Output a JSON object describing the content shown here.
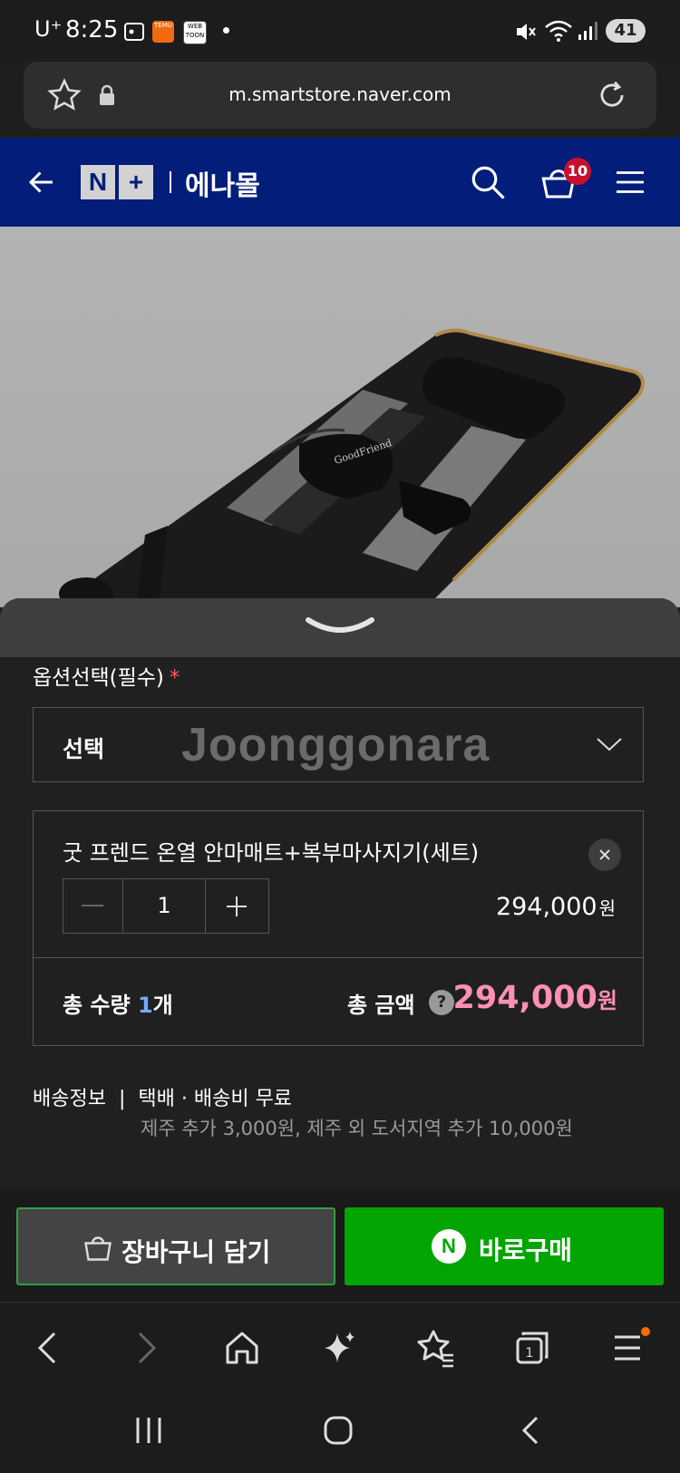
{
  "status_bar": {
    "carrier": "U⁺",
    "time": "8:25",
    "apps": [
      "TEMU",
      "WEB TOON"
    ],
    "battery": "41"
  },
  "url_bar": {
    "url": "m.smartstore.naver.com"
  },
  "store_header": {
    "logo_left": "N",
    "logo_right": "+",
    "store_name": "에나몰",
    "cart_count": "10"
  },
  "product_image": {
    "brand_text": "GoodFriend"
  },
  "options": {
    "label": "옵션선택(필수)",
    "required_mark": "*",
    "select_value": "선택",
    "watermark": "Joonggonara"
  },
  "selected_item": {
    "name": "굿 프렌드 온열 안마매트+복부마사지기(세트)",
    "quantity": "1",
    "price": "294,000",
    "price_unit": "원"
  },
  "total": {
    "quantity_label": "총 수량",
    "quantity_value": "1",
    "quantity_unit": "개",
    "amount_label": "총 금액",
    "help": "?",
    "amount": "294,000",
    "amount_unit": "원"
  },
  "shipping": {
    "label": "배송정보",
    "divider": "|",
    "method": "택배 · 배송비 무료",
    "extra": "제주 추가 3,000원, 제주 외 도서지역 추가 10,000원"
  },
  "actions": {
    "cart_label": "장바구니 담기",
    "buy_icon": "N",
    "buy_label": "바로구매"
  },
  "browser_nav": {
    "tabs_count": "1"
  },
  "colors": {
    "header_bg": "#021d7a",
    "buy_green": "#03a503",
    "price_pink": "#ff8fb5",
    "badge_red": "#c8102e"
  }
}
